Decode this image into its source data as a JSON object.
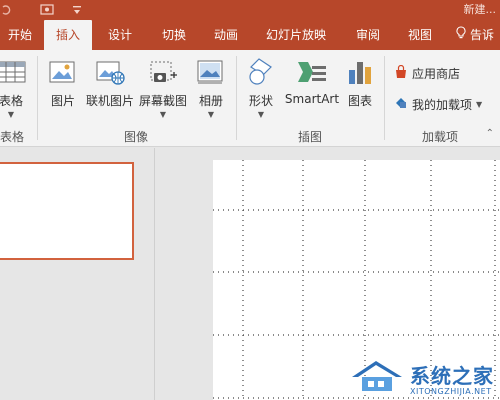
{
  "window": {
    "title": "新建...",
    "title_bar_color": "#b7472a"
  },
  "quick_access": {
    "icons": [
      "undo-icon",
      "redo-icon",
      "present-from-start-icon",
      "customize-qat-icon"
    ]
  },
  "tabs": [
    {
      "label": "开始",
      "active": false
    },
    {
      "label": "插入",
      "active": true
    },
    {
      "label": "设计",
      "active": false
    },
    {
      "label": "切换",
      "active": false
    },
    {
      "label": "动画",
      "active": false
    },
    {
      "label": "幻灯片放映",
      "active": false
    },
    {
      "label": "审阅",
      "active": false
    },
    {
      "label": "视图",
      "active": false
    },
    {
      "label": "告诉",
      "active": false
    }
  ],
  "ribbon": {
    "groups": {
      "table": {
        "label": "表格",
        "button_label": "表格"
      },
      "images": {
        "label": "图像",
        "buttons": [
          "图片",
          "联机图片",
          "屏幕截图",
          "相册"
        ]
      },
      "illustrations": {
        "label": "插图",
        "buttons": [
          "形状",
          "SmartArt",
          "图表"
        ]
      },
      "addins": {
        "label": "加载项",
        "buttons": [
          "应用商店",
          "我的加载项"
        ]
      }
    }
  },
  "watermark": {
    "main": "系统之家",
    "sub": "XITONGZHIJIA.NET"
  },
  "colors": {
    "accent": "#b7472a",
    "selection_border": "#d2623e",
    "watermark": "#2d6fb8"
  }
}
